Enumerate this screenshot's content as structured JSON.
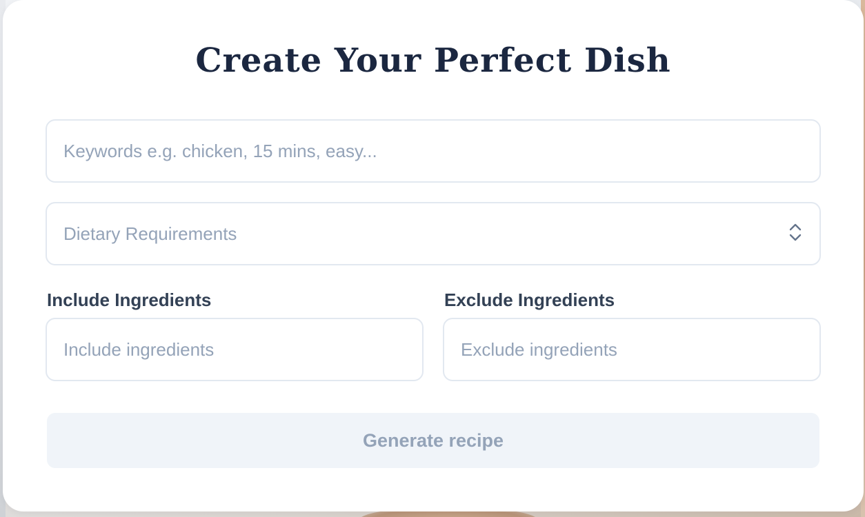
{
  "form": {
    "title": "Create Your Perfect Dish",
    "keywords": {
      "value": "",
      "placeholder": "Keywords e.g. chicken, 15 mins, easy..."
    },
    "dietary": {
      "selected": "Dietary Requirements"
    },
    "include": {
      "label": "Include Ingredients",
      "value": "",
      "placeholder": "Include ingredients"
    },
    "exclude": {
      "label": "Exclude Ingredients",
      "value": "",
      "placeholder": "Exclude ingredients"
    },
    "generate_label": "Generate recipe"
  },
  "icons": {
    "dietary_toggle": "chevron-up-down-icon"
  },
  "colors": {
    "title": "#1b2740",
    "label": "#334155",
    "placeholder": "#94a3b8",
    "border": "#e2e8f0",
    "button_bg": "#f0f4f9",
    "button_text": "#94a3b8"
  }
}
